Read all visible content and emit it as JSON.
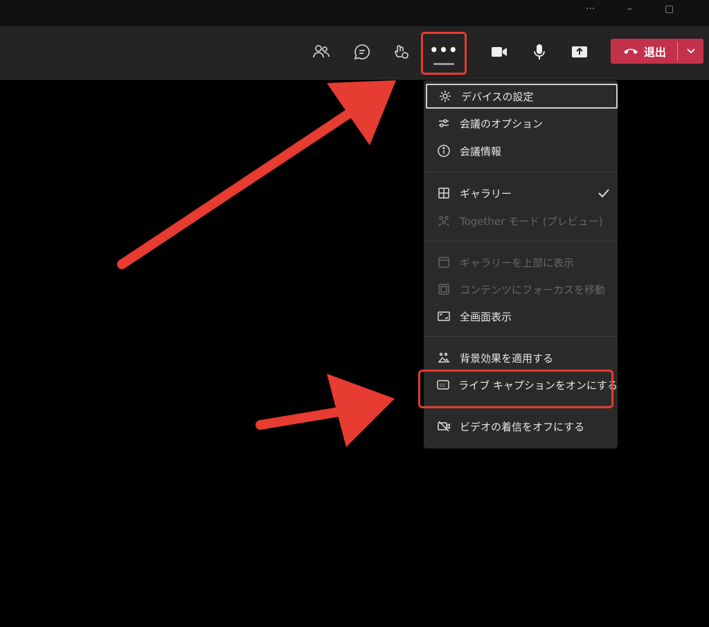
{
  "window_controls": {
    "more": "···",
    "minimize": "–",
    "restore": "▢"
  },
  "toolbar": {
    "buttons": [
      {
        "name": "participants-icon"
      },
      {
        "name": "chat-icon"
      },
      {
        "name": "reactions-icon"
      },
      {
        "name": "camera-icon"
      },
      {
        "name": "microphone-icon"
      },
      {
        "name": "share-icon"
      }
    ],
    "more_label": "•••",
    "leave_label": "退出"
  },
  "menu": {
    "items": [
      {
        "label": "デバイスの設定",
        "icon": "gear-icon"
      },
      {
        "label": "会議のオプション",
        "icon": "sliders-icon"
      },
      {
        "label": "会議情報",
        "icon": "info-icon"
      },
      {
        "label": "ギャラリー",
        "icon": "gallery-icon",
        "checked": true
      },
      {
        "label": "Together モード (プレビュー)",
        "icon": "together-icon",
        "disabled": true
      },
      {
        "label": "ギャラリーを上部に表示",
        "icon": "gallery-top-icon",
        "disabled": true
      },
      {
        "label": "コンテンツにフォーカスを移動",
        "icon": "focus-icon",
        "disabled": true
      },
      {
        "label": "全画面表示",
        "icon": "fullscreen-icon"
      },
      {
        "label": "背景効果を適用する",
        "icon": "background-effects-icon"
      },
      {
        "label": "ライブ キャプションをオンにする",
        "icon": "captions-icon"
      },
      {
        "label": "ビデオの着信をオフにする",
        "icon": "video-off-icon"
      }
    ]
  },
  "colors": {
    "accent_red": "#e63c31",
    "leave_red": "#c4314b",
    "menu_bg": "#2a2a2a",
    "toolbar_bg": "#242424"
  }
}
